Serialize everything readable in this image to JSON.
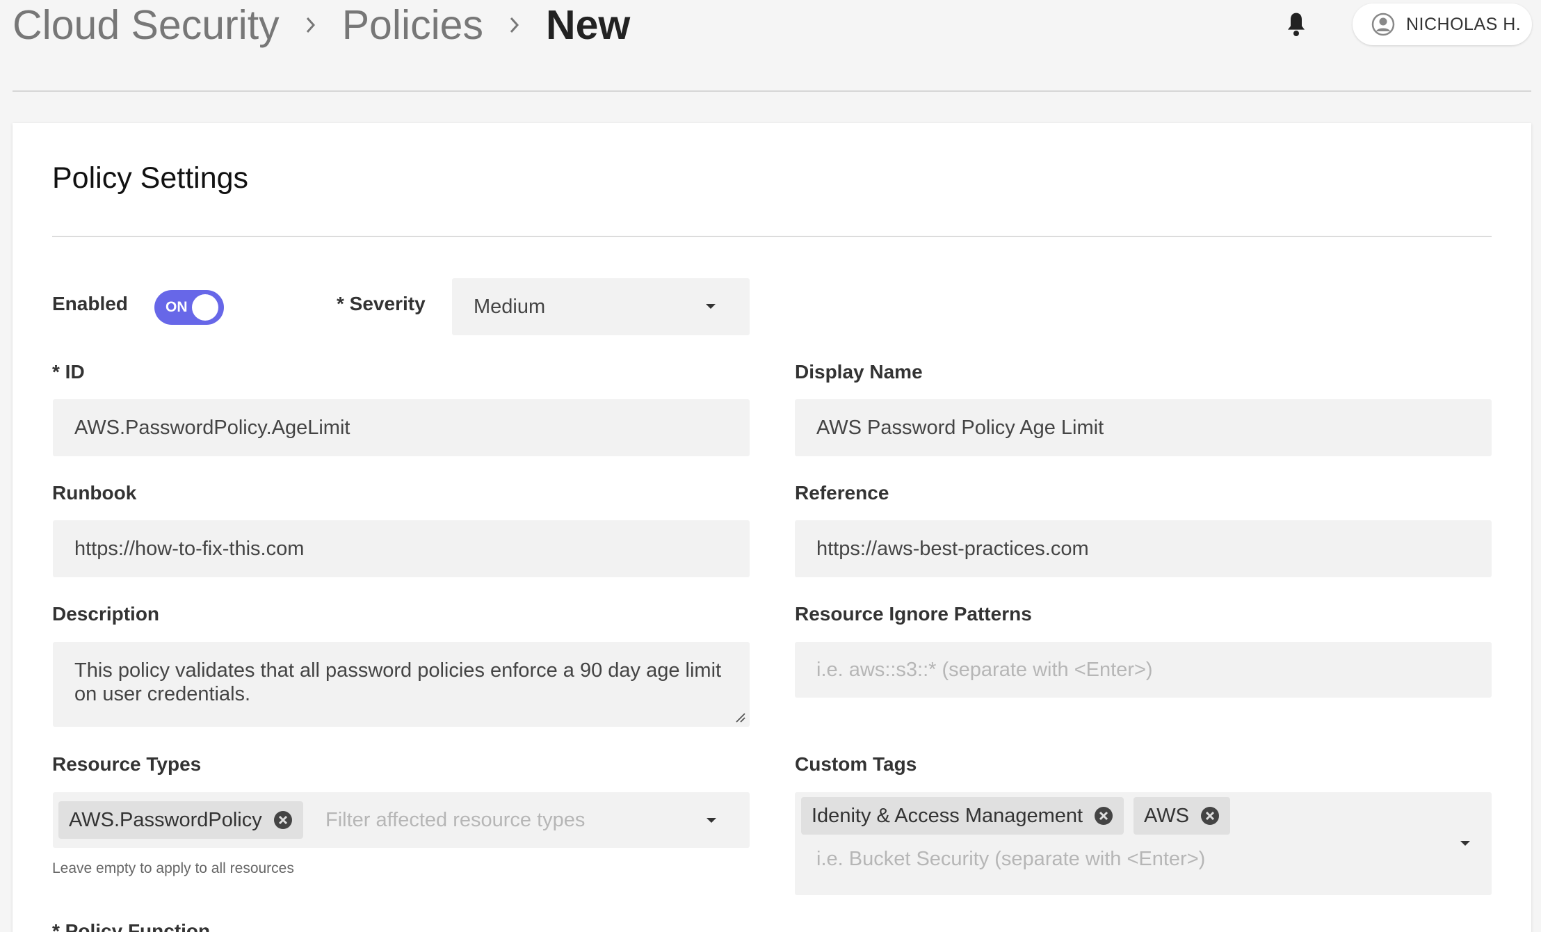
{
  "breadcrumb": {
    "items": [
      "Cloud Security",
      "Policies",
      "New"
    ]
  },
  "header": {
    "user_name": "NICHOLAS H."
  },
  "card": {
    "title": "Policy Settings"
  },
  "form": {
    "enabled_label": "Enabled",
    "enabled_state": "ON",
    "severity_label": "* Severity",
    "severity_value": "Medium",
    "id_label": "* ID",
    "id_value": "AWS.PasswordPolicy.AgeLimit",
    "display_name_label": "Display Name",
    "display_name_value": "AWS Password Policy Age Limit",
    "runbook_label": "Runbook",
    "runbook_value": "https://how-to-fix-this.com",
    "reference_label": "Reference",
    "reference_value": "https://aws-best-practices.com",
    "description_label": "Description",
    "description_value": "This policy validates that all password policies enforce a 90 day age limit on user credentials.",
    "ignore_patterns_label": "Resource Ignore Patterns",
    "ignore_patterns_placeholder": "i.e. aws::s3::* (separate with <Enter>)",
    "resource_types_label": "Resource Types",
    "resource_types_chips": [
      "AWS.PasswordPolicy"
    ],
    "resource_types_placeholder": "Filter affected resource types",
    "resource_types_helper": "Leave empty to apply to all resources",
    "custom_tags_label": "Custom Tags",
    "custom_tags_chips": [
      "Idenity & Access Management",
      "AWS"
    ],
    "custom_tags_placeholder": "i.e. Bucket Security (separate with <Enter>)",
    "policy_function_label": "* Policy Function"
  },
  "colors": {
    "toggle_on": "#6767e8",
    "page_bg": "#f5f5f5",
    "field_bg": "#f2f2f2"
  }
}
